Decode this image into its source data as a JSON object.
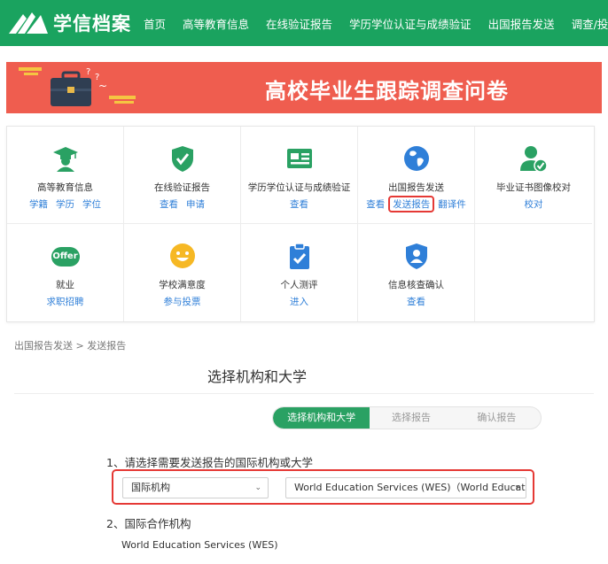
{
  "header": {
    "logo_text": "学信档案",
    "nav": [
      "首页",
      "高等教育信息",
      "在线验证报告",
      "学历学位认证与成绩验证",
      "出国报告发送",
      "调查/投票"
    ]
  },
  "banner": {
    "title": "高校毕业生跟踪调查问卷"
  },
  "grid": {
    "cells": [
      {
        "title": "高等教育信息",
        "links": [
          "学籍",
          "学历",
          "学位"
        ],
        "icon": "graduate-icon"
      },
      {
        "title": "在线验证报告",
        "links": [
          "查看",
          "申请"
        ],
        "icon": "shield-check-icon"
      },
      {
        "title": "学历学位认证与成绩验证",
        "links": [
          "查看"
        ],
        "icon": "certificate-icon"
      },
      {
        "title": "出国报告发送",
        "links": [
          "查看",
          "发送报告",
          "翻译件"
        ],
        "icon": "globe-icon"
      },
      {
        "title": "毕业证书图像校对",
        "links": [
          "校对"
        ],
        "icon": "user-check-icon"
      },
      {
        "title": "就业",
        "links": [
          "求职招聘"
        ],
        "icon": "offer-icon"
      },
      {
        "title": "学校满意度",
        "links": [
          "参与投票"
        ],
        "icon": "smiley-icon"
      },
      {
        "title": "个人测评",
        "links": [
          "进入"
        ],
        "icon": "clipboard-check-icon"
      },
      {
        "title": "信息核查确认",
        "links": [
          "查看"
        ],
        "icon": "person-shield-icon"
      }
    ],
    "offer_badge": "Offer"
  },
  "breadcrumb": {
    "parent": "出国报告发送",
    "separator": ">",
    "current": "发送报告"
  },
  "page_title": "选择机构和大学",
  "steps": [
    "选择机构和大学",
    "选择报告",
    "确认报告"
  ],
  "form": {
    "question1": "1、请选择需要发送报告的国际机构或大学",
    "select_type": "国际机构",
    "select_org": "World Education Services (WES)（World Educati...",
    "question2": "2、国际合作机构",
    "org_name": "World Education Services (WES)"
  },
  "colors": {
    "brand_green": "#1aa35f",
    "banner_red": "#ef5d4f",
    "link_blue": "#2f7fd8",
    "highlight_red": "#e53935"
  }
}
